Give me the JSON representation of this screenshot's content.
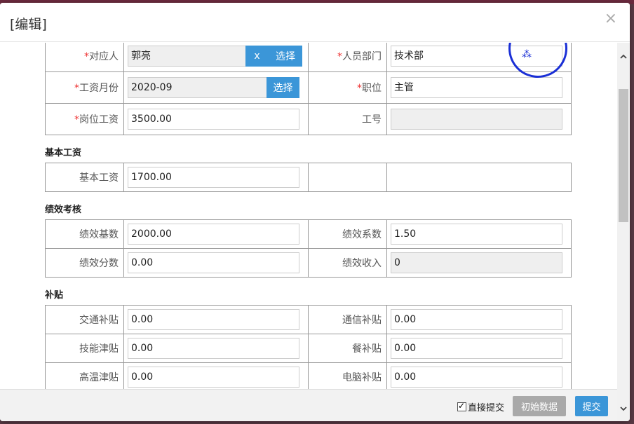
{
  "dialog": {
    "title": "[编辑]",
    "close_glyph": "×"
  },
  "top_table": {
    "row1": {
      "label_left": "对应人",
      "value_left": "郭亮",
      "x_label": "x",
      "select_label": "选择",
      "label_right": "人员部门",
      "value_right": "技术部"
    },
    "row2": {
      "label_left": "工资月份",
      "value_left": "2020-09",
      "select_label": "选择",
      "label_right": "职位",
      "value_right": "主管"
    },
    "row3": {
      "label_left": "岗位工资",
      "value_left": "3500.00",
      "label_right": "工号",
      "value_right": ""
    },
    "required_mark": "*"
  },
  "sections": {
    "basic": {
      "title": "基本工资",
      "label": "基本工资",
      "value": "1700.00"
    },
    "performance": {
      "title": "绩效考核",
      "base_label": "绩效基数",
      "base_value": "2000.00",
      "coef_label": "绩效系数",
      "coef_value": "1.50",
      "score_label": "绩效分数",
      "score_value": "0.00",
      "income_label": "绩效收入",
      "income_value": "0"
    },
    "allowance": {
      "title": "补贴",
      "traffic_label": "交通补贴",
      "traffic_value": "0.00",
      "comm_label": "通信补贴",
      "comm_value": "0.00",
      "skill_label": "技能津贴",
      "skill_value": "0.00",
      "meal_label": "餐补贴",
      "meal_value": "0.00",
      "heat_label": "高温津贴",
      "heat_value": "0.00",
      "pc_label": "电脑补贴",
      "pc_value": "0.00"
    }
  },
  "footer": {
    "direct_submit_label": "直接提交",
    "init_label": "初始数据",
    "submit_label": "提交"
  },
  "colors": {
    "accent": "#3b96d8",
    "required": "#e33333",
    "stamp": "#1a2fd6"
  }
}
